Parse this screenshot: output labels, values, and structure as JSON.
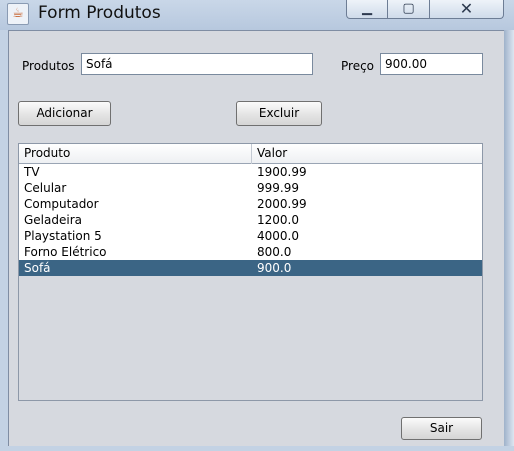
{
  "window": {
    "title": "Form Produtos",
    "icon": "java-cup-icon"
  },
  "form": {
    "produto_label": "Produtos",
    "produto_value": "Sofá",
    "preco_label": "Preço",
    "preco_value": "900.00"
  },
  "buttons": {
    "adicionar": "Adicionar",
    "excluir": "Excluir",
    "sair": "Sair"
  },
  "table": {
    "columns": [
      "Produto",
      "Valor"
    ],
    "rows": [
      [
        "TV",
        "1900.99"
      ],
      [
        "Celular",
        "999.99"
      ],
      [
        "Computador",
        "2000.99"
      ],
      [
        "Geladeira",
        "1200.0"
      ],
      [
        "Playstation 5",
        "4000.0"
      ],
      [
        "Forno Elétrico",
        "800.0"
      ],
      [
        "Sofá",
        "900.0"
      ]
    ],
    "selected_row": 6,
    "selection_color": "#3b6585"
  }
}
